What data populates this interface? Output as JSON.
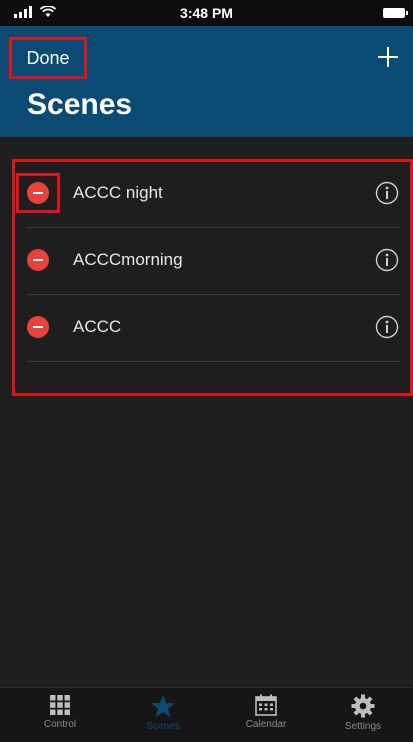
{
  "status_bar": {
    "time": "3:48 PM"
  },
  "nav": {
    "done_label": "Done",
    "title": "Scenes"
  },
  "scenes": [
    {
      "label": "ACCC night"
    },
    {
      "label": "ACCCmorning"
    },
    {
      "label": "ACCC"
    }
  ],
  "tab_bar": {
    "tabs": [
      {
        "label": "Control",
        "icon": "grid-icon"
      },
      {
        "label": "Scenes",
        "icon": "star-icon",
        "active": true
      },
      {
        "label": "Calendar",
        "icon": "calendar-icon"
      },
      {
        "label": "Settings",
        "icon": "gear-icon"
      }
    ]
  },
  "colors": {
    "header": "#0b4a73",
    "background": "#1e1e1e",
    "delete": "#e8433a",
    "highlight": "#e0141e"
  }
}
